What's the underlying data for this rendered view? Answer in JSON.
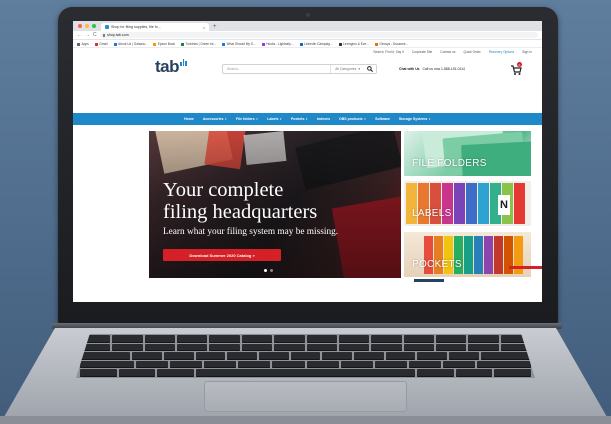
{
  "browser": {
    "tab_title": "Shop for filing supplies, file fo...",
    "tab_close": "×",
    "new_tab": "+",
    "url": "shop.tab.com",
    "back": "←",
    "forward": "→",
    "reload": "C",
    "bookmarks": [
      {
        "label": "Apps",
        "color": "#5f6368"
      },
      {
        "label": "Gmail",
        "color": "#d93025"
      },
      {
        "label": "About Us | Galaxia...",
        "color": "#1a73e8"
      },
      {
        "label": "Epson Book",
        "color": "#f29900"
      },
      {
        "label": "Turbines | Green ke...",
        "color": "#188038"
      },
      {
        "label": "What Should My S...",
        "color": "#1a73e8"
      },
      {
        "label": "Hooks - Lightstrip...",
        "color": "#9334e6"
      },
      {
        "label": "LinkedIn Campaig...",
        "color": "#0a66c2"
      },
      {
        "label": "Lexington & Eve...",
        "color": "#333333"
      },
      {
        "label": "Geosys - Dussnes...",
        "color": "#e37400"
      }
    ]
  },
  "site": {
    "utility_links": [
      "Search, Find it, Say it",
      "Corporate Site",
      "Contact us",
      "Quick Order",
      "Recovery Options",
      "Sign In"
    ],
    "logo_text": "tab",
    "search_placeholder": "Search...",
    "search_category": "All Categories",
    "chat_label": "Chat with Us",
    "call_label": "Call us now 1-888-191-0114",
    "cart_count": "0",
    "nav": [
      {
        "label": "Home",
        "caret": false
      },
      {
        "label": "Accessories",
        "caret": true
      },
      {
        "label": "File folders",
        "caret": true
      },
      {
        "label": "Labels",
        "caret": true
      },
      {
        "label": "Pockets",
        "caret": true
      },
      {
        "label": "Indexes",
        "caret": false
      },
      {
        "label": "OBS products",
        "caret": true
      },
      {
        "label": "Software",
        "caret": false
      },
      {
        "label": "Storage Systems",
        "caret": true
      }
    ]
  },
  "hero": {
    "headline_line1": "Your complete",
    "headline_line2": "filing headquarters",
    "subtext": "Learn what your filing system may be missing.",
    "cta": "Download Summer 2020 Catalog »",
    "slide_count": 2,
    "active_slide": 1
  },
  "tiles": [
    {
      "label": "FILE FOLDERS"
    },
    {
      "label": "LABELS"
    },
    {
      "label": "POCKETS"
    }
  ],
  "tile_n_letter": "N",
  "colors": {
    "brand_navy": "#27425e",
    "brand_blue": "#1e88c8",
    "cta_red": "#d62027"
  }
}
